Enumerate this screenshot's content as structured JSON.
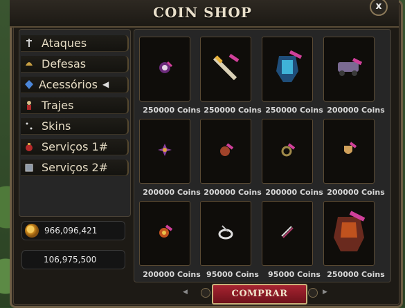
{
  "window": {
    "title": "COIN SHOP",
    "close_label": "x"
  },
  "categories": [
    {
      "label": "Ataques",
      "icon": "sword-icon"
    },
    {
      "label": "Defesas",
      "icon": "helmet-icon"
    },
    {
      "label": "Acessórios",
      "icon": "gem-icon"
    },
    {
      "label": "Trajes",
      "icon": "costume-icon"
    },
    {
      "label": "Skins",
      "icon": "sparkle-icon"
    },
    {
      "label": "Serviços 1#",
      "icon": "bag-icon"
    },
    {
      "label": "Serviços 2#",
      "icon": "box-icon"
    }
  ],
  "wallet": {
    "coins": "966,096,421",
    "cash": "106,975,500"
  },
  "items": [
    {
      "price": "250000 Coins",
      "icon": "amulet-icon"
    },
    {
      "price": "250000 Coins",
      "icon": "wand-icon"
    },
    {
      "price": "250000 Coins",
      "icon": "armor-icon"
    },
    {
      "price": "200000 Coins",
      "icon": "cart-icon"
    },
    {
      "price": "200000 Coins",
      "icon": "star-pendant-icon"
    },
    {
      "price": "200000 Coins",
      "icon": "pendant-icon"
    },
    {
      "price": "200000 Coins",
      "icon": "ring-icon"
    },
    {
      "price": "200000 Coins",
      "icon": "shield-icon"
    },
    {
      "price": "200000 Coins",
      "icon": "emblem-icon"
    },
    {
      "price": "95000 Coins",
      "icon": "ring-silver-icon"
    },
    {
      "price": "95000 Coins",
      "icon": "scroll-icon"
    },
    {
      "price": "250000 Coins",
      "icon": "dragon-armor-icon"
    }
  ],
  "actions": {
    "buy_label": "COMPRAR"
  },
  "colors": {
    "accent": "#a72431",
    "border": "#6e5e45",
    "text": "#e9dfca"
  }
}
